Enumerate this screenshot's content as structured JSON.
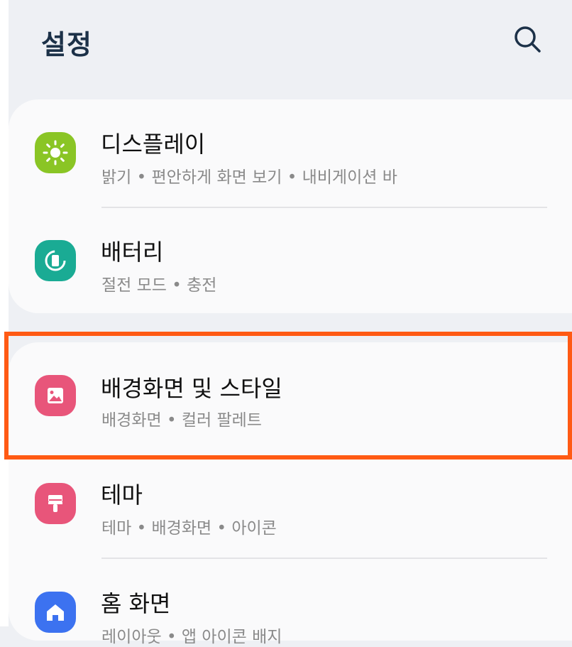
{
  "header": {
    "title": "설정"
  },
  "items": [
    {
      "title": "디스플레이",
      "subtitle": "밝기  •  편안하게 화면 보기  •  내비게이션 바",
      "icon": "display-brightness-icon",
      "color": "#8ac525"
    },
    {
      "title": "배터리",
      "subtitle": "절전 모드  •  충전",
      "icon": "battery-icon",
      "color": "#1aab94"
    },
    {
      "title": "배경화면 및 스타일",
      "subtitle": "배경화면  •  컬러 팔레트",
      "icon": "wallpaper-icon",
      "color": "#e8557a"
    },
    {
      "title": "테마",
      "subtitle": "테마  •  배경화면  •  아이콘",
      "icon": "theme-brush-icon",
      "color": "#e8557a"
    },
    {
      "title": "홈 화면",
      "subtitle": "레이아웃  •  앱 아이콘 배지",
      "icon": "home-icon",
      "color": "#3c72f0"
    }
  ],
  "colors": {
    "highlight": "#ff5a14",
    "header_text": "#1c3148"
  }
}
